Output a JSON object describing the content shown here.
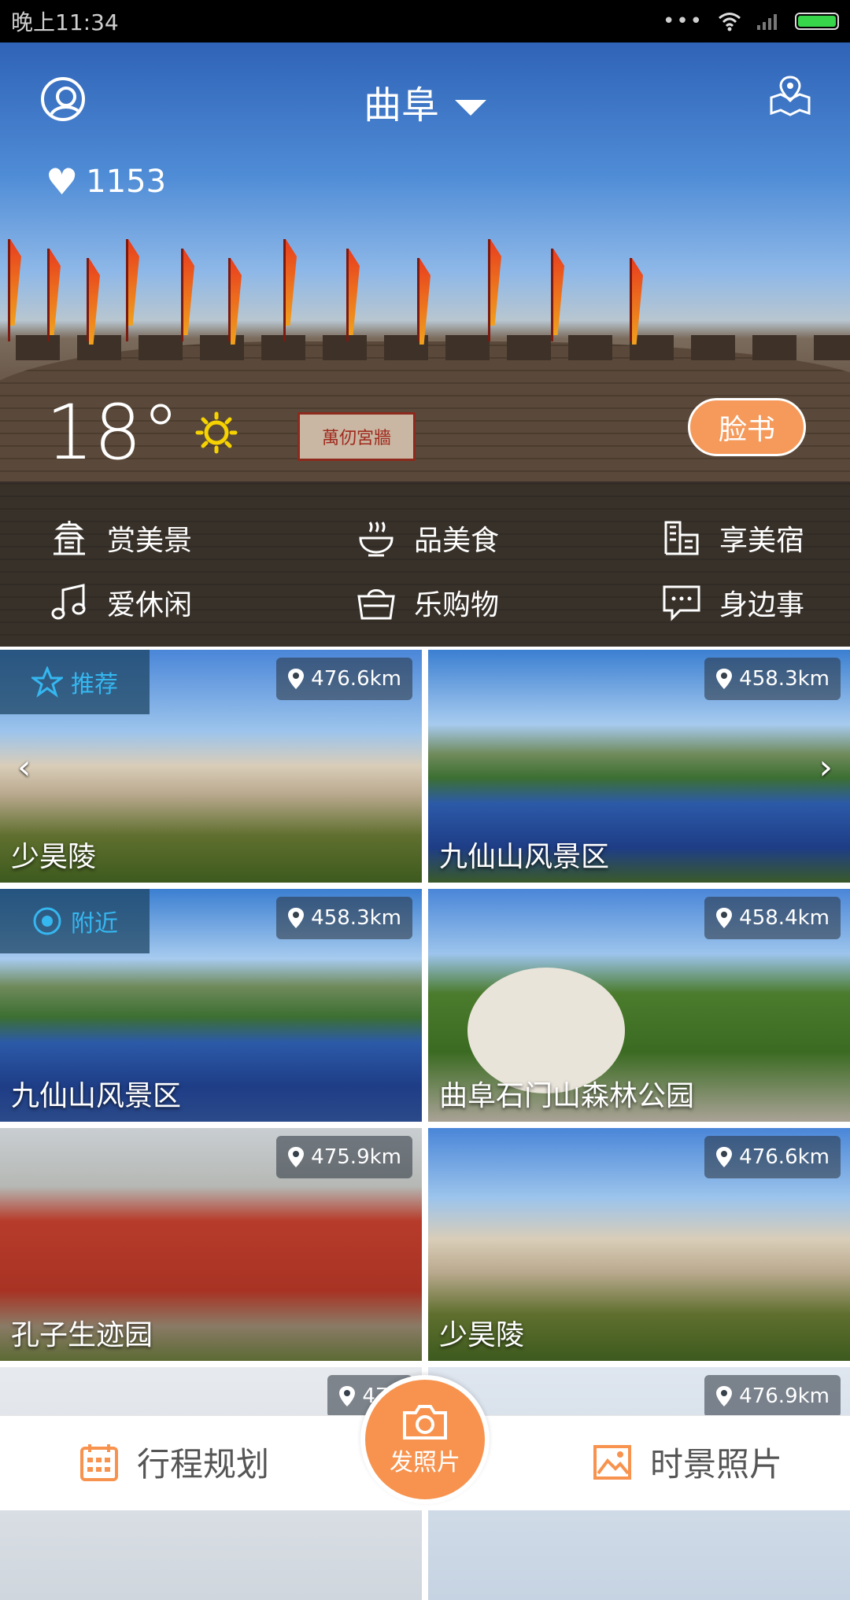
{
  "status_bar": {
    "time": "晚上11:34",
    "dots": "•••"
  },
  "header": {
    "city": "曲阜",
    "likes": "1153"
  },
  "weather": {
    "temp": "18°"
  },
  "facebook_button": "脸书",
  "hero": {
    "gate_sign": "萬仞宮牆"
  },
  "menu": [
    {
      "label": "赏美景",
      "icon": "pagoda-icon"
    },
    {
      "label": "品美食",
      "icon": "bowl-icon"
    },
    {
      "label": "享美宿",
      "icon": "building-icon"
    },
    {
      "label": "爱休闲",
      "icon": "music-icon"
    },
    {
      "label": "乐购物",
      "icon": "basket-icon"
    },
    {
      "label": "身边事",
      "icon": "chat-icon"
    }
  ],
  "cards": [
    {
      "name": "少昊陵",
      "distance": "476.6km",
      "tag": "推荐"
    },
    {
      "name": "九仙山风景区",
      "distance": "458.3km"
    },
    {
      "name": "九仙山风景区",
      "distance": "458.3km",
      "tag": "附近"
    },
    {
      "name": "曲阜石门山森林公园",
      "distance": "458.4km"
    },
    {
      "name": "孔子生迹园",
      "distance": "475.9km"
    },
    {
      "name": "少昊陵",
      "distance": "476.6km"
    },
    {
      "name": "",
      "distance": "476"
    },
    {
      "name": "",
      "distance": "476.9km"
    }
  ],
  "carousel": {
    "prev": "‹",
    "next": "›"
  },
  "bottom_bar": {
    "left": "行程规划",
    "center": "发照片",
    "right": "时景照片"
  },
  "colors": {
    "accent_orange": "#f7934f",
    "tag_blue": "#35b7f0"
  }
}
